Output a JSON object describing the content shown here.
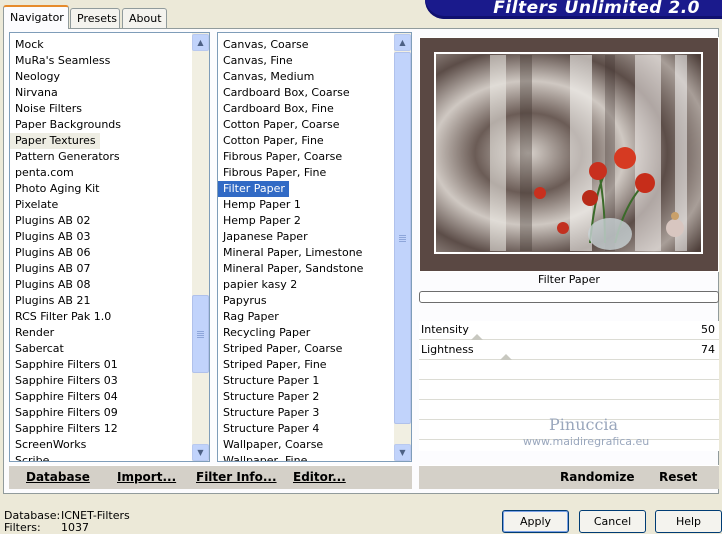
{
  "tabs": [
    {
      "label": "Navigator"
    },
    {
      "label": "Presets"
    },
    {
      "label": "About"
    }
  ],
  "banner": {
    "title": "Filters Unlimited 2.0"
  },
  "categories": {
    "items": [
      "Mock",
      "MuRa's Seamless",
      "Neology",
      "Nirvana",
      "Noise Filters",
      "Paper Backgrounds",
      "Paper Textures",
      "Pattern Generators",
      "penta.com",
      "Photo Aging Kit",
      "Pixelate",
      "Plugins AB 02",
      "Plugins AB 03",
      "Plugins AB 06",
      "Plugins AB 07",
      "Plugins AB 08",
      "Plugins AB 21",
      "RCS Filter Pak 1.0",
      "Render",
      "Sabercat",
      "Sapphire Filters 01",
      "Sapphire Filters 03",
      "Sapphire Filters 04",
      "Sapphire Filters 09",
      "Sapphire Filters 12",
      "ScreenWorks",
      "Scribe"
    ],
    "selected": "Paper Textures"
  },
  "filters": {
    "items": [
      "Canvas, Coarse",
      "Canvas, Fine",
      "Canvas, Medium",
      "Cardboard Box, Coarse",
      "Cardboard Box, Fine",
      "Cotton Paper, Coarse",
      "Cotton Paper, Fine",
      "Fibrous Paper, Coarse",
      "Fibrous Paper, Fine",
      "Filter Paper",
      "Hemp Paper 1",
      "Hemp Paper 2",
      "Japanese Paper",
      "Mineral Paper, Limestone",
      "Mineral Paper, Sandstone",
      "papier kasy 2",
      "Papyrus",
      "Rag Paper",
      "Recycling Paper",
      "Striped Paper, Coarse",
      "Striped Paper, Fine",
      "Structure Paper 1",
      "Structure Paper 2",
      "Structure Paper 3",
      "Structure Paper 4",
      "Wallpaper, Coarse",
      "Wallpaper, Fine"
    ],
    "selected": "Filter Paper"
  },
  "toolbar_left": {
    "database": "Database",
    "import": "Import...",
    "filter_info": "Filter Info...",
    "editor": "Editor..."
  },
  "toolbar_right": {
    "randomize": "Randomize",
    "reset": "Reset"
  },
  "preview": {
    "filter_name": "Filter Paper"
  },
  "sliders": [
    {
      "label": "Intensity",
      "value": "50"
    },
    {
      "label": "Lightness",
      "value": "74"
    }
  ],
  "watermark": {
    "line1": "Pinuccia",
    "line2": "www.maidiregrafica.eu"
  },
  "status": {
    "database_label": "Database:",
    "database_value": "ICNET-Filters",
    "filters_label": "Filters:",
    "filters_value": "1037"
  },
  "buttons": {
    "apply": "Apply",
    "cancel": "Cancel",
    "help": "Help"
  },
  "colors": {
    "banner": "#1a1a8c",
    "selection": "#316ac5",
    "scroll": "#c1d3fb"
  }
}
